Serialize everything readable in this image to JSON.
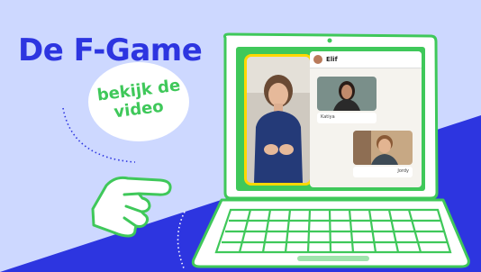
{
  "hero": {
    "title": "De F-Game",
    "badge_line1": "bekijk de",
    "badge_line2": "video"
  },
  "call": {
    "contact_name": "Elif",
    "messages": [
      {
        "sender": "Katiya"
      },
      {
        "sender": "Jordy"
      }
    ]
  },
  "colors": {
    "background_light": "#cdd8ff",
    "background_blue": "#2d35e0",
    "laptop_green": "#3fc85a",
    "title_blue": "#2d35e0",
    "badge_text_green": "#3fc85a",
    "video_border_yellow": "#ffd800"
  },
  "icons": [
    "pointing-hand-icon",
    "webcam-icon",
    "keyboard-icon"
  ]
}
